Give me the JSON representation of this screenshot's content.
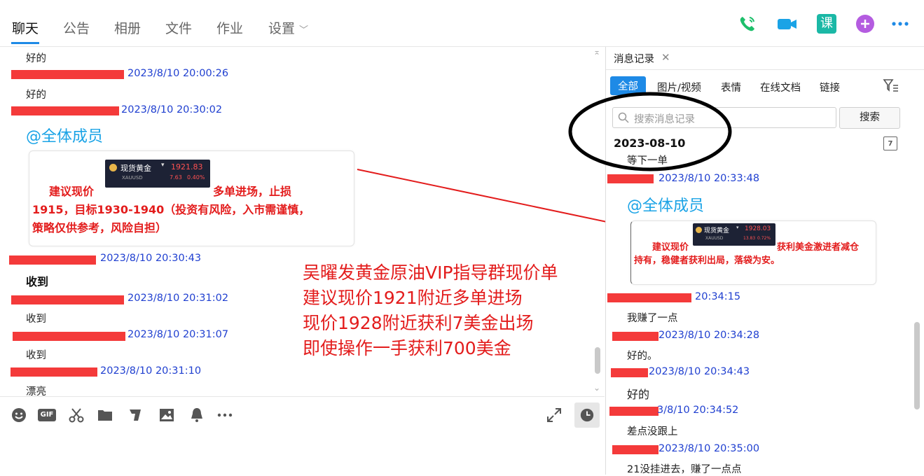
{
  "tabs": [
    "聊天",
    "公告",
    "相册",
    "文件",
    "作业",
    "设置"
  ],
  "top_icons": [
    "phone-icon",
    "video-icon",
    "class-icon",
    "add-app-icon",
    "more-icon"
  ],
  "class_icon_char": "课",
  "chat": {
    "messages": [
      {
        "text": "好的"
      },
      {
        "time": "2023/8/10 20:00:26"
      },
      {
        "text": "好的"
      },
      {
        "time": "2023/8/10 20:30:02"
      },
      {
        "mention": "@全体成员"
      },
      {
        "time": "2023/8/10 20:30:43"
      },
      {
        "text": "收到"
      },
      {
        "time": "2023/8/10 20:31:02"
      },
      {
        "text": "收到"
      },
      {
        "time": "2023/8/10 20:31:07"
      },
      {
        "text": "收到"
      },
      {
        "time": "2023/8/10 20:31:10"
      },
      {
        "text": "漂亮"
      }
    ],
    "card": {
      "line1_prefix": "建议现价",
      "line1_suffix": "多单进场，止损",
      "line2": "1915，目标1930-1940（投资有风险，入市需谨慎，",
      "line3": "策略仅供参考，风险自担）",
      "ticker_name": "现货黄金",
      "ticker_code": "XAUUSD",
      "ticker_price": "1921.83",
      "ticker_change": "7.63",
      "ticker_pct": "0.40%"
    }
  },
  "overlay": {
    "lines": [
      "吴曜发黄金原油VIP指导群现价单",
      "建议现价1921附近多单进场",
      "现价1928附近获利7美金出场",
      "即使操作一手获利700美金"
    ]
  },
  "toolbar_icons": [
    "emoji-icon",
    "gif-icon",
    "scissors-icon",
    "folder-icon",
    "music-icon",
    "image-icon",
    "bell-icon",
    "more-icon"
  ],
  "toolbar_gif_label": "GIF",
  "history": {
    "tab_title": "消息记录",
    "filters": [
      "全部",
      "图片/视频",
      "表情",
      "在线文档",
      "链接"
    ],
    "search_placeholder": "搜索消息记录",
    "search_button": "搜索",
    "date_header": "2023-08-10",
    "calendar_day": "7",
    "messages": [
      {
        "text": "等下一单"
      },
      {
        "time": "2023/8/10 20:33:48"
      },
      {
        "mention": "@全体成员"
      },
      {
        "time": "20:34:15"
      },
      {
        "text": "我赚了一点"
      },
      {
        "time": "2023/8/10 20:34:28"
      },
      {
        "text": "好的。"
      },
      {
        "time": "2023/8/10 20:34:43"
      },
      {
        "text": "好的"
      },
      {
        "time": "3/8/10 20:34:52"
      },
      {
        "text": "差点没跟上"
      },
      {
        "time": "2023/8/10 20:35:00"
      },
      {
        "text": "21没挂进去，赚了一点点"
      }
    ],
    "card": {
      "prefix": "建议现价",
      "suffix": "获利美金激进者减仓",
      "line2": "持有，稳健者获利出局，落袋为安。",
      "ticker_name": "现货黄金",
      "ticker_code": "XAUUSD",
      "ticker_price": "1928.03",
      "ticker_change": "13.83",
      "ticker_pct": "0.72%"
    }
  },
  "colors": {
    "accent": "#1e8ae6",
    "timestamp": "#1f3fd0",
    "mention": "#1aa3e6",
    "alert_red": "#e31c1c",
    "redact": "#f43a3a"
  }
}
